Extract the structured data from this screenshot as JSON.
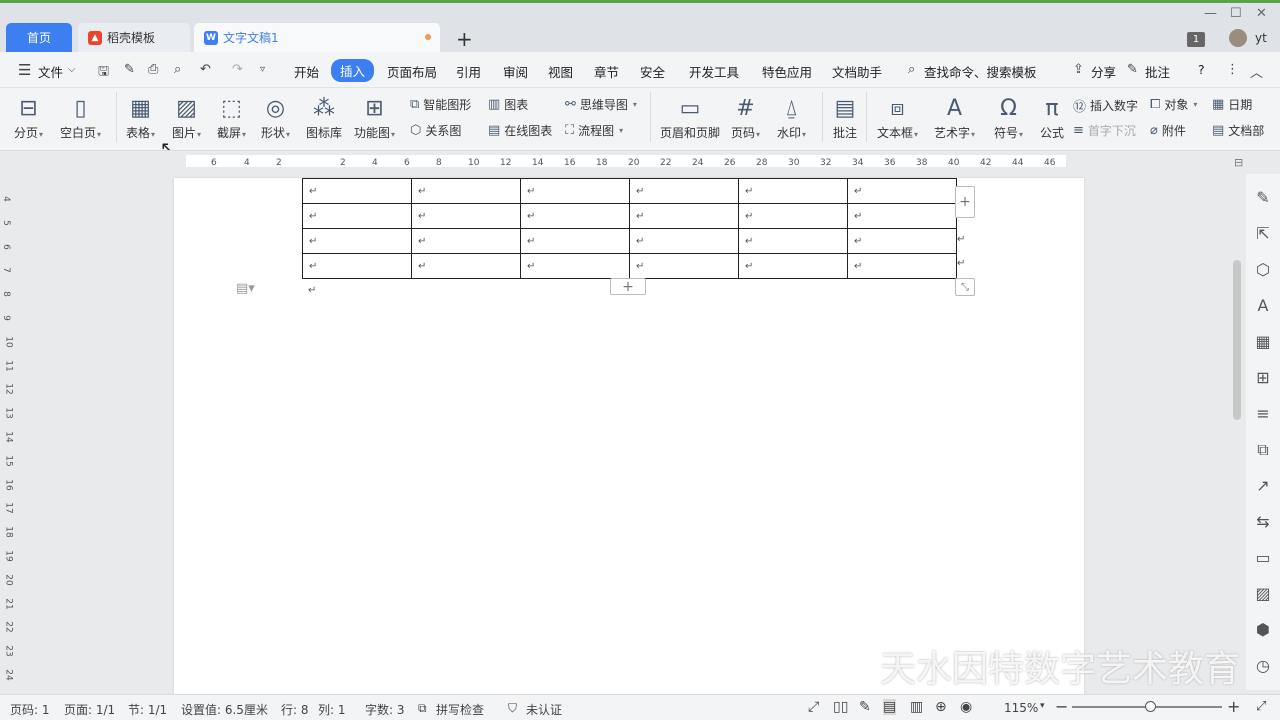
{
  "tabs": [
    {
      "label": "首页"
    },
    {
      "label": "稻壳模板"
    },
    {
      "label": "文字文稿1"
    }
  ],
  "titlebar": {
    "badge": "1",
    "user": "yt",
    "new_tab": "+"
  },
  "menu": {
    "file": "文件",
    "items": [
      "开始",
      "插入",
      "页面布局",
      "引用",
      "审阅",
      "视图",
      "章节",
      "安全",
      "开发工具",
      "特色应用",
      "文档助手"
    ],
    "active": "插入",
    "search": "查找命令、搜索模板",
    "share": "分享",
    "comment": "批注",
    "help": "?"
  },
  "ribbon": {
    "big": [
      "分页",
      "空白页",
      "表格",
      "图片",
      "截屏",
      "形状",
      "图标库",
      "功能图",
      "页眉和页脚",
      "页码",
      "水印",
      "批注",
      "文本框",
      "艺术字",
      "符号",
      "公式"
    ],
    "small": [
      "智能图形",
      "关系图",
      "图表",
      "在线图表",
      "思维导图",
      "流程图",
      "插入数字",
      "首字下沉",
      "对象",
      "附件",
      "日期",
      "文档部"
    ]
  },
  "ruler": {
    "ticks": [
      "6",
      "4",
      "2",
      "2",
      "4",
      "6",
      "8",
      "10",
      "12",
      "14",
      "16",
      "18",
      "20",
      "22",
      "24",
      "26",
      "28",
      "30",
      "32",
      "34",
      "36",
      "38",
      "40",
      "42",
      "44",
      "46"
    ]
  },
  "vruler": {
    "ticks": [
      "4",
      "5",
      "6",
      "7",
      "8",
      "9",
      "10",
      "11",
      "12",
      "13",
      "14",
      "15",
      "16",
      "17",
      "18",
      "19",
      "20",
      "21",
      "22",
      "23",
      "24"
    ]
  },
  "table": {
    "rows": 4,
    "cols": 6,
    "cell": "↵"
  },
  "para_mark": "↵",
  "status": {
    "page_code": "页码: 1",
    "page": "页面: 1/1",
    "section": "节: 1/1",
    "setting": "设置值: 6.5厘米",
    "row": "行: 8",
    "col": "列: 1",
    "words": "字数: 3",
    "spell": "拼写检查",
    "cert": "未认证",
    "zoom": "115%"
  },
  "watermark": "天水因特数字艺术教育"
}
